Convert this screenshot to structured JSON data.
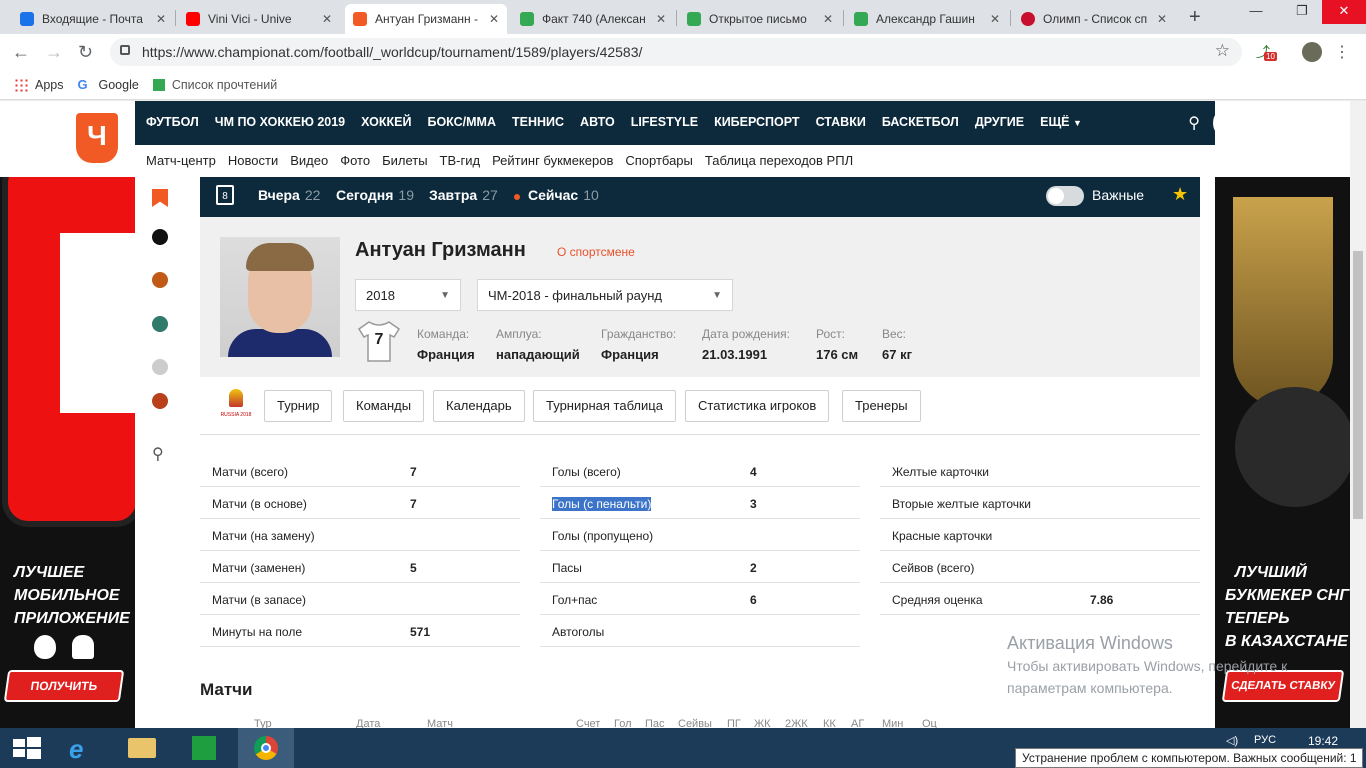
{
  "browser": {
    "tabs": [
      {
        "title": "Входящие - Почта",
        "color": "#1a73e8"
      },
      {
        "title": "Vini Vici - Unive",
        "color": "#ff0000"
      },
      {
        "title": "Антуан Гризманн -",
        "color": "#f15a24"
      },
      {
        "title": "Факт 740 (Алексан",
        "color": "#34a853"
      },
      {
        "title": "Открытое письмо",
        "color": "#34a853"
      },
      {
        "title": "Александр Гашин",
        "color": "#34a853"
      },
      {
        "title": "Олимп - Список сп",
        "color": "#c8102e"
      }
    ],
    "url": "https://www.championat.com/football/_worldcup/tournament/1589/players/42583/",
    "extension_badge": "10",
    "bookmarks": [
      {
        "label": "Apps"
      },
      {
        "label": "Google"
      },
      {
        "label": "Список прочтений"
      }
    ]
  },
  "site": {
    "logo_letter": "Ч",
    "nav": [
      "ФУТБОЛ",
      "ЧМ ПО ХОККЕЮ 2019",
      "ХОККЕЙ",
      "БОКС/ММА",
      "ТЕННИС",
      "АВТО",
      "LIFESTYLE",
      "КИБЕРСПОРТ",
      "СТАВКИ",
      "БАСКЕТБОЛ",
      "ДРУГИЕ",
      "ЕЩЁ"
    ],
    "subnav": [
      "Матч-центр",
      "Новости",
      "Видео",
      "Фото",
      "Билеты",
      "ТВ-гид",
      "Рейтинг букмекеров",
      "Спортбары",
      "Таблица переходов РПЛ"
    ]
  },
  "matchbar": {
    "calendar_day": "8",
    "items": [
      {
        "label": "Вчера",
        "count": "22"
      },
      {
        "label": "Сегодня",
        "count": "19"
      },
      {
        "label": "Завтра",
        "count": "27"
      },
      {
        "label": "Сейчас",
        "count": "10"
      }
    ],
    "important_label": "Важные"
  },
  "player": {
    "name": "Антуан Гризманн",
    "about_link": "О спортсмене",
    "season": "2018",
    "stage": "ЧМ-2018 - финальный раунд",
    "number": "7",
    "attrs": [
      {
        "label": "Команда:",
        "value": "Франция"
      },
      {
        "label": "Амплуа:",
        "value": "нападающий"
      },
      {
        "label": "Гражданство:",
        "value": "Франция"
      },
      {
        "label": "Дата рождения:",
        "value": "21.03.1991"
      },
      {
        "label": "Рост:",
        "value": "176 см"
      },
      {
        "label": "Вес:",
        "value": "67 кг"
      }
    ]
  },
  "tournament": {
    "logo_text": "RUSSIA 2018",
    "buttons": [
      "Турнир",
      "Команды",
      "Календарь",
      "Турнирная таблица",
      "Статистика игроков",
      "Тренеры"
    ]
  },
  "stats": {
    "col1": [
      {
        "k": "Матчи (всего)",
        "v": "7"
      },
      {
        "k": "Матчи (в основе)",
        "v": "7"
      },
      {
        "k": "Матчи (на замену)",
        "v": ""
      },
      {
        "k": "Матчи (заменен)",
        "v": "5"
      },
      {
        "k": "Матчи (в запасе)",
        "v": ""
      },
      {
        "k": "Минуты на поле",
        "v": "571"
      }
    ],
    "col2": [
      {
        "k": "Голы (всего)",
        "v": "4"
      },
      {
        "k": "Голы (с пенальти)",
        "v": "3"
      },
      {
        "k": "Голы (пропущено)",
        "v": ""
      },
      {
        "k": "Пасы",
        "v": "2"
      },
      {
        "k": "Гол+пас",
        "v": "6"
      },
      {
        "k": "Автоголы",
        "v": ""
      }
    ],
    "col3": [
      {
        "k": "Желтые карточки",
        "v": ""
      },
      {
        "k": "Вторые желтые карточки",
        "v": ""
      },
      {
        "k": "Красные карточки",
        "v": ""
      },
      {
        "k": "Сейвов (всего)",
        "v": ""
      },
      {
        "k": "Средняя оценка",
        "v": "7.86"
      }
    ]
  },
  "matches": {
    "title": "Матчи",
    "headers": [
      "Тур",
      "Дата",
      "Матч",
      "Счет",
      "Гол",
      "Пас",
      "Сейвы",
      "ПГ",
      "ЖК",
      "2ЖК",
      "КК",
      "АГ",
      "Мин",
      "Оц"
    ]
  },
  "ads": {
    "left_text": [
      "ЛУЧШЕЕ",
      "МОБИЛЬНОЕ",
      "ПРИЛОЖЕНИЕ"
    ],
    "left_button": "ПОЛУЧИТЬ",
    "right_text": [
      "ЛУЧШИЙ",
      "БУКМЕКЕР СНГ",
      "ТЕПЕРЬ",
      "В КАЗАХСТАНЕ"
    ],
    "right_button": "СДЕЛАТЬ СТАВКУ"
  },
  "watermark": {
    "line1": "Активация Windows",
    "line2": "Чтобы активировать Windows, перейдите к",
    "line3": "параметрам компьютера."
  },
  "taskbar": {
    "lang": "РУС",
    "time": "19:42",
    "notification": "Устранение проблем с компьютером. Важных сообщений: 1"
  }
}
